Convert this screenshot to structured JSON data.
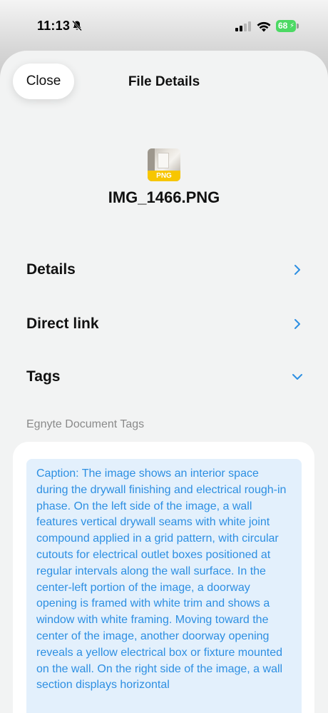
{
  "status_bar": {
    "time": "11:13",
    "battery": "68",
    "icons": [
      "bell-slash-icon",
      "signal-icon",
      "wifi-icon",
      "battery-icon"
    ]
  },
  "sheet": {
    "close_label": "Close",
    "title": "File Details"
  },
  "file": {
    "type_badge": "PNG",
    "name": "IMG_1466.PNG"
  },
  "rows": {
    "details": "Details",
    "direct_link": "Direct link",
    "tags": "Tags"
  },
  "tags_section": {
    "label": "Egnyte Document Tags",
    "caption": "Caption: The image shows an interior space during the drywall finishing and electrical rough-in phase. On the left side of the image, a wall features vertical drywall seams with white joint compound applied in a grid pattern, with circular cutouts for electrical outlet boxes positioned at regular intervals along the wall surface. In the center-left portion of the image, a doorway opening is framed with white trim and shows a window with white framing. Moving toward the center of the image, another doorway opening reveals a yellow electrical box or fixture mounted on the wall. On the right side of the image, a wall section displays horizontal"
  },
  "colors": {
    "accent": "#2d8fe2",
    "caption_bg": "#e3f0fc",
    "badge": "#f7c600",
    "battery": "#4cd964"
  }
}
